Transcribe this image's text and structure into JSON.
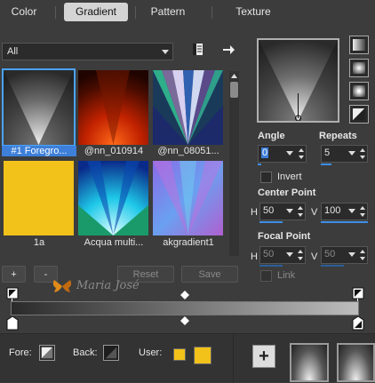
{
  "tabs": [
    {
      "label": "Color"
    },
    {
      "label": "Gradient"
    },
    {
      "label": "Pattern"
    },
    {
      "label": "Texture"
    }
  ],
  "filter": {
    "selected": "All"
  },
  "thumbnails": [
    {
      "label": "#1 Foregro..."
    },
    {
      "label": "@nn_010914"
    },
    {
      "label": "@nn_08051..."
    },
    {
      "label": "1a"
    },
    {
      "label": "Acqua multi..."
    },
    {
      "label": "akgradient1"
    }
  ],
  "list_buttons": {
    "add": "+",
    "remove": "-",
    "reset": "Reset",
    "save": "Save"
  },
  "watermark": "Maria José",
  "angle": {
    "label": "Angle",
    "value": "0"
  },
  "repeats": {
    "label": "Repeats",
    "value": "5"
  },
  "invert": {
    "label": "Invert"
  },
  "center_point": {
    "label": "Center Point",
    "h_label": "H",
    "h_value": "50",
    "v_label": "V",
    "v_value": "100"
  },
  "focal_point": {
    "label": "Focal Point",
    "h_label": "H",
    "h_value": "50",
    "v_label": "V",
    "v_value": "50"
  },
  "link": {
    "label": "Link"
  },
  "footer": {
    "fore_label": "Fore:",
    "back_label": "Back:",
    "user_label": "User:",
    "add": "+"
  },
  "colors": {
    "accent": "#3d7fd9",
    "swatch_yellow": "#f2c11a"
  }
}
